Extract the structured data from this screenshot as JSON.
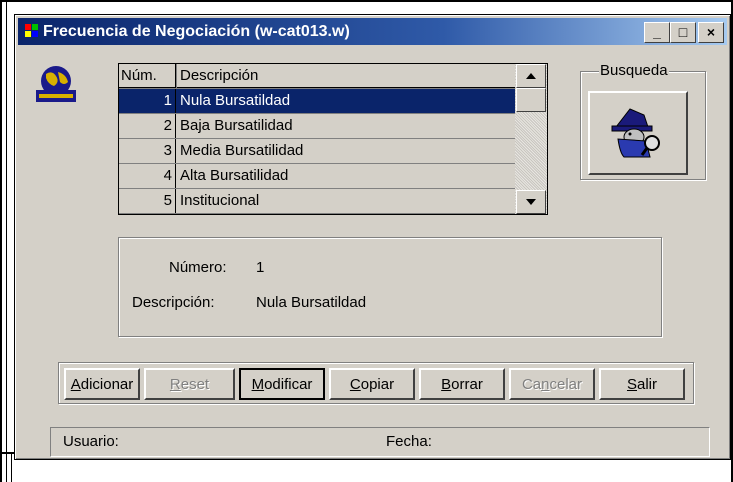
{
  "window": {
    "title": "Frecuencia de Negociación (w-cat013.w)",
    "controls": {
      "minimize": "_",
      "maximize": "□",
      "close": "×"
    }
  },
  "grid": {
    "columns": [
      "Núm.",
      "Descripción"
    ],
    "rows": [
      {
        "num": "1",
        "desc": "Nula Bursatildad",
        "selected": true
      },
      {
        "num": "2",
        "desc": "Baja Bursatilidad",
        "selected": false
      },
      {
        "num": "3",
        "desc": "Media Bursatilidad",
        "selected": false
      },
      {
        "num": "4",
        "desc": "Alta Bursatilidad",
        "selected": false
      },
      {
        "num": "5",
        "desc": "Institucional",
        "selected": false
      }
    ]
  },
  "search": {
    "group_label": "Busqueda",
    "icon": "detective-search-icon"
  },
  "details": {
    "numero_label": "Número:",
    "numero_value": "1",
    "descripcion_label": "Descripción:",
    "descripcion_value": "Nula Bursatildad"
  },
  "buttons": {
    "adicionar": {
      "pre": "",
      "key": "A",
      "post": "dicionar"
    },
    "reset": {
      "pre": "",
      "key": "R",
      "post": "eset"
    },
    "modificar": {
      "pre": "",
      "key": "M",
      "post": "odificar"
    },
    "copiar": {
      "pre": "",
      "key": "C",
      "post": "opiar"
    },
    "borrar": {
      "pre": "",
      "key": "B",
      "post": "orrar"
    },
    "cancelar": {
      "pre": "Ca",
      "key": "n",
      "post": "celar"
    },
    "salir": {
      "pre": "",
      "key": "S",
      "post": "alir"
    }
  },
  "status": {
    "usuario_label": "Usuario:",
    "fecha_label": "Fecha:"
  },
  "colors": {
    "title_start": "#0a246a",
    "title_end": "#a6caf0",
    "face": "#d4d0c8",
    "selection": "#0a246a"
  }
}
